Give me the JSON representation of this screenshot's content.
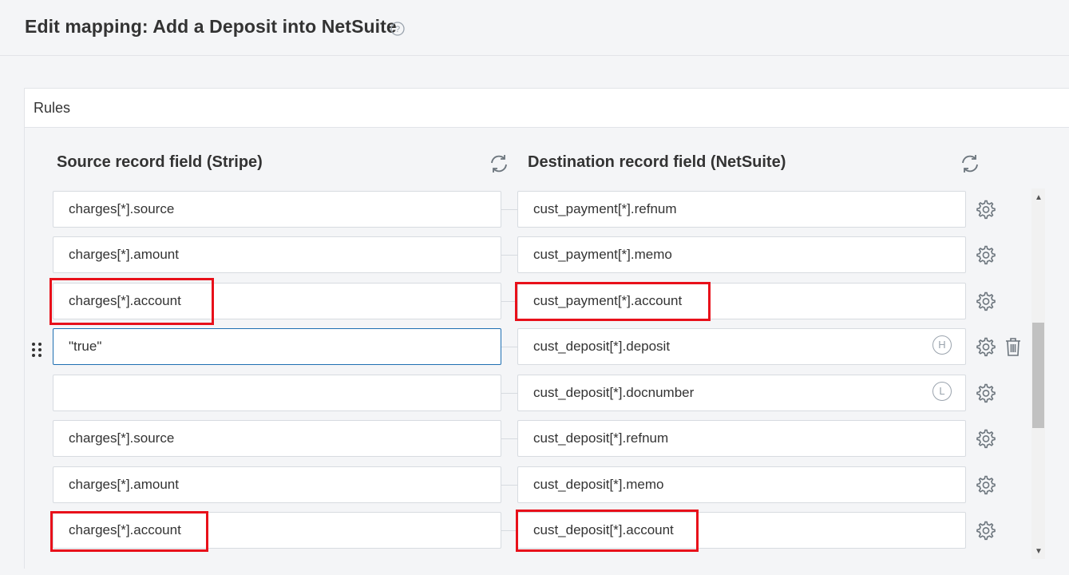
{
  "page": {
    "title": "Edit mapping: Add a Deposit into NetSuite",
    "help_icon": "question-circle-icon"
  },
  "panel": {
    "title": "Rules",
    "source_header": "Source record field (Stripe)",
    "destination_header": "Destination record field (NetSuite)",
    "refresh_icon": "refresh-icon"
  },
  "rows": [
    {
      "source": "charges[*].source",
      "destination": "cust_payment[*].refnum",
      "badge": ""
    },
    {
      "source": "charges[*].amount",
      "destination": "cust_payment[*].memo",
      "badge": ""
    },
    {
      "source": "charges[*].account",
      "destination": "cust_payment[*].account",
      "badge": "",
      "highlighted": true
    },
    {
      "source": "\"true\"",
      "destination": "cust_deposit[*].deposit",
      "badge": "H",
      "active": true
    },
    {
      "source": "",
      "destination": "cust_deposit[*].docnumber",
      "badge": "L"
    },
    {
      "source": "charges[*].source",
      "destination": "cust_deposit[*].refnum",
      "badge": ""
    },
    {
      "source": "charges[*].amount",
      "destination": "cust_deposit[*].memo",
      "badge": ""
    },
    {
      "source": "charges[*].account",
      "destination": "cust_deposit[*].account",
      "badge": "",
      "highlighted": true
    }
  ],
  "colors": {
    "highlight": "#e8101a",
    "active_border": "#1f6fb2",
    "background": "#f4f5f7"
  }
}
